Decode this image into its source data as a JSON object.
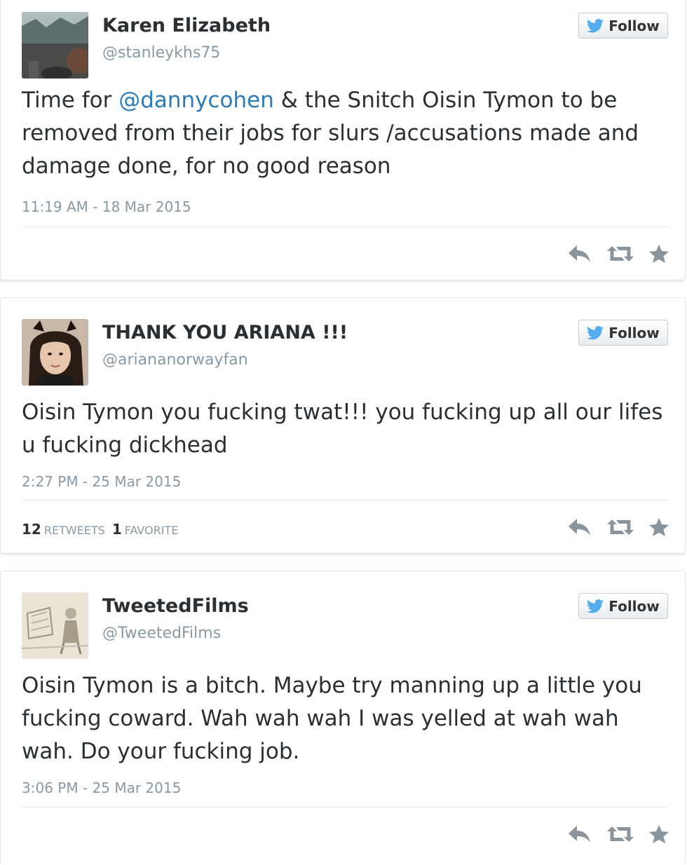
{
  "colors": {
    "link": "#2b7bb9",
    "muted": "#8899a6",
    "text": "#292f33",
    "twitter_blue": "#55acee",
    "icon_grey": "#8a949c"
  },
  "follow_label": "Follow",
  "tweets": [
    {
      "display_name": "Karen Elizabeth",
      "handle": "@stanleykhs75",
      "text_before": "Time for ",
      "mention": "@dannycohen",
      "text_after": " & the Snitch Oisin Tymon to be removed from their jobs for slurs /accusations made and damage done, for no good reason",
      "timestamp": "11:19 AM - 18 Mar 2015",
      "avatar_icon": "avatar-photo"
    },
    {
      "display_name": "THANK YOU ARIANA !!!",
      "handle": "@ariananorwayfan",
      "text": "Oisin Tymon you fucking twat!!! you fucking up all our lifes u fucking dickhead",
      "timestamp": "2:27 PM - 25 Mar 2015",
      "retweets_count": "12",
      "retweets_label": "RETWEETS",
      "favorites_count": "1",
      "favorites_label": "FAVORITE",
      "avatar_icon": "avatar-photo"
    },
    {
      "display_name": "TweetedFilms",
      "handle": "@TweetedFilms",
      "text": "Oisin Tymon is a bitch. Maybe try manning up a little you fucking coward. Wah wah wah I was yelled at wah wah wah. Do your fucking job.",
      "timestamp": "3:06 PM - 25 Mar 2015",
      "avatar_icon": "avatar-sketch"
    }
  ],
  "action_icons": [
    "reply-icon",
    "retweet-icon",
    "favorite-star-icon"
  ]
}
